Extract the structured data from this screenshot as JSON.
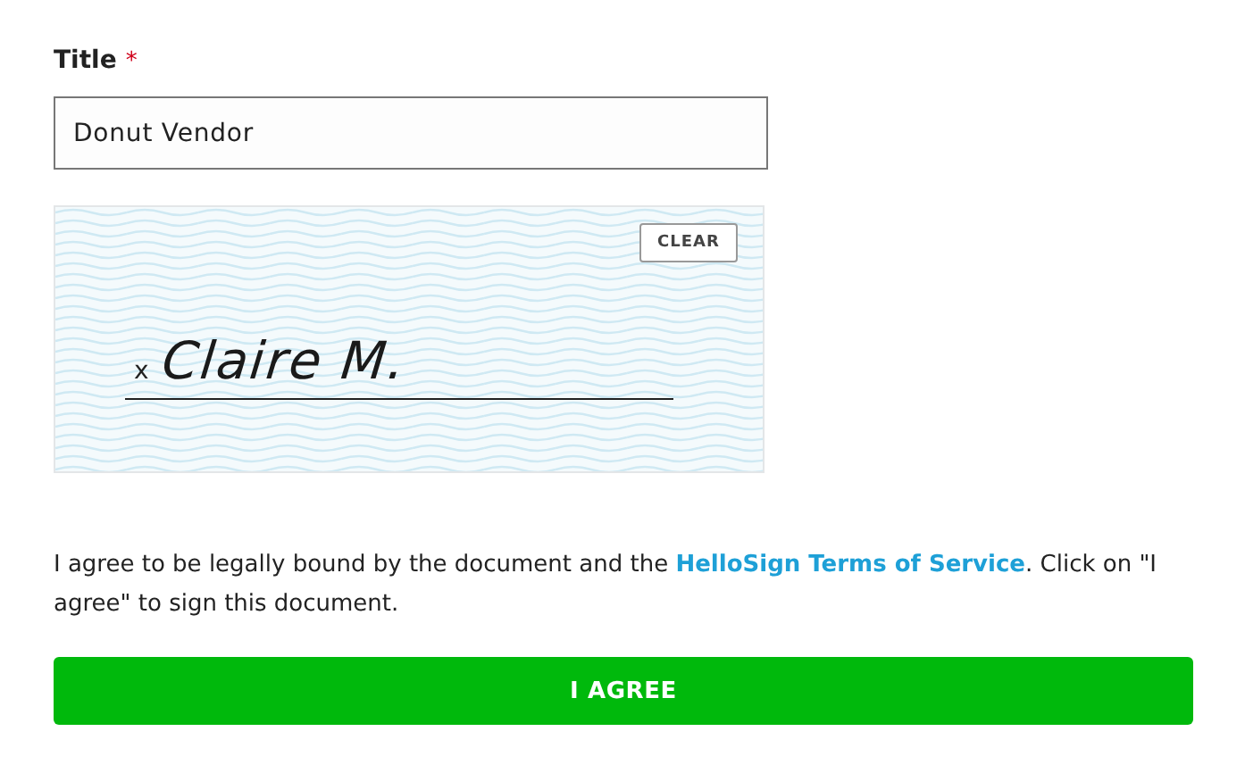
{
  "title_field": {
    "label": "Title",
    "required_mark": "*",
    "value": "Donut Vendor"
  },
  "signature_pad": {
    "clear_button": "CLEAR",
    "sign_mark": "x",
    "signature": "Claire M."
  },
  "agreement": {
    "before": "I agree to be legally bound by the document and the ",
    "link": "HelloSign Terms of Service",
    "after": ". Click on \"I agree\" to sign this document."
  },
  "agree_button": "I AGREE"
}
